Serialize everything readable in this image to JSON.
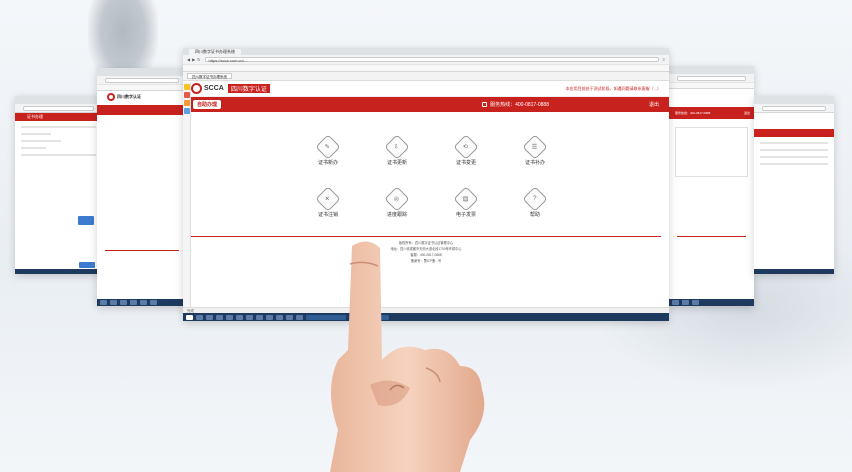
{
  "main_window": {
    "tab_title": "四川数字证书办理系统",
    "url": "https://scca.com.cn/...",
    "brand_name": "四川数字认证",
    "brand_abbr": "SCCA",
    "notice": "本应用目前处于测试阶段，如遇问题请联系客服（...）",
    "nav_home": "自助办理",
    "hotline": "服务热线：400-0817-0888",
    "user_label": "退出",
    "services": [
      {
        "label": "证书新办",
        "icon": "certificate-new-icon"
      },
      {
        "label": "证书更新",
        "icon": "certificate-update-icon"
      },
      {
        "label": "证书变更",
        "icon": "certificate-change-icon"
      },
      {
        "label": "证书补办",
        "icon": "certificate-reissue-icon"
      },
      {
        "label": "证书注销",
        "icon": "certificate-cancel-icon"
      },
      {
        "label": "进度跟踪",
        "icon": "progress-tracking-icon"
      },
      {
        "label": "电子发票",
        "icon": "invoice-icon"
      },
      {
        "label": "帮助",
        "icon": "help-icon"
      }
    ],
    "footer": [
      "版权所有：四川数字证书认证管理中心",
      "地址：四川省成都市天府大道北段1700号环球中心",
      "客服：400-0817-0888",
      "备案号：蜀ICP备...号"
    ],
    "status_text": "完成"
  },
  "left_window_2": {
    "brand_name": "四川数字认证"
  },
  "left_window_1": {
    "title": "证书办理"
  },
  "right_window_3": {
    "hotline": "服务热线：400-0817-0888",
    "user_label": "退出"
  },
  "colors": {
    "accent": "#c8221f",
    "taskbar": "#1f3a5f"
  }
}
